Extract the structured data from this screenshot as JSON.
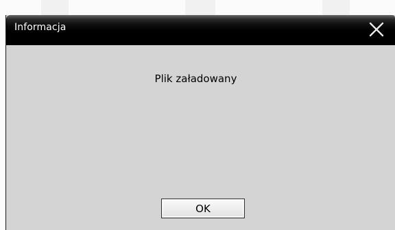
{
  "dialog": {
    "title": "Informacja",
    "message": "Plik załadowany",
    "ok_label": "OK",
    "close_icon": "close-icon"
  },
  "colors": {
    "titlebar": "#000000",
    "title_text": "#ffffff",
    "dialog_background": "#d4d4d4"
  }
}
